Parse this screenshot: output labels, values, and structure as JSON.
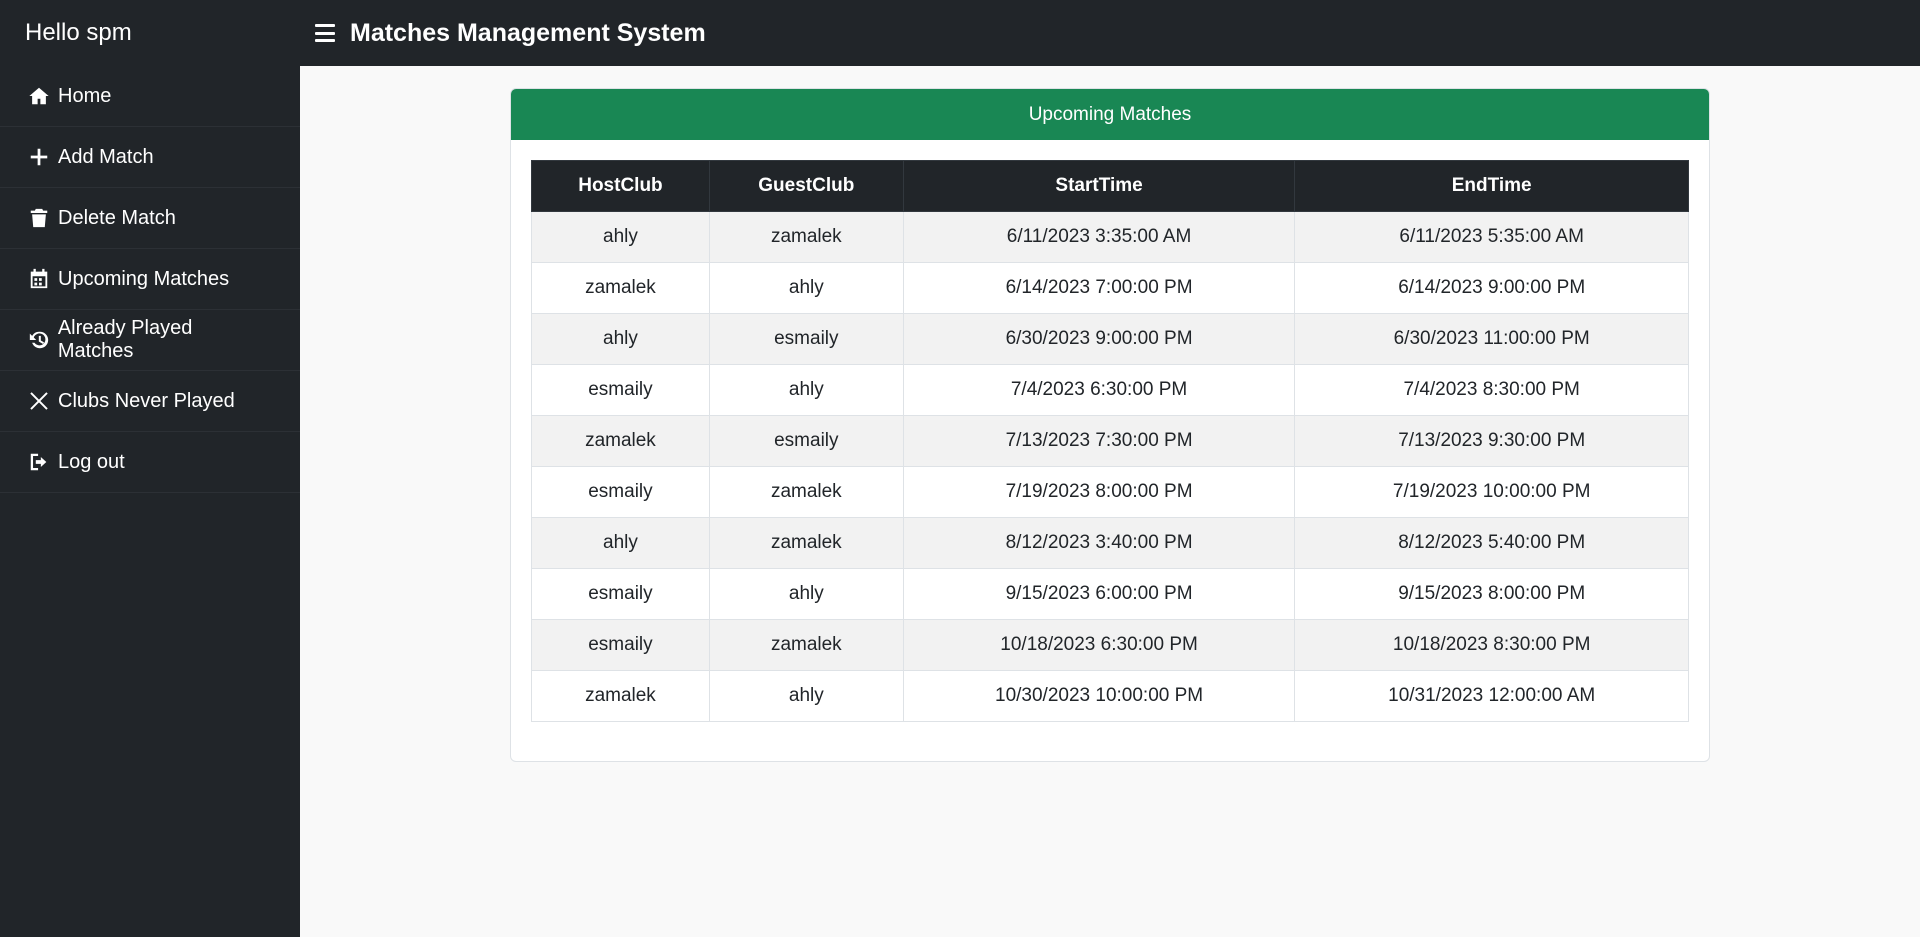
{
  "sidebar": {
    "greeting": "Hello spm",
    "items": [
      {
        "label": "Home",
        "icon": "home-icon"
      },
      {
        "label": "Add Match",
        "icon": "plus-icon"
      },
      {
        "label": "Delete Match",
        "icon": "trash-icon"
      },
      {
        "label": "Upcoming Matches",
        "icon": "calendar-icon"
      },
      {
        "label": "Already Played Matches",
        "icon": "history-icon"
      },
      {
        "label": "Clubs Never Played",
        "icon": "x-icon"
      },
      {
        "label": "Log out",
        "icon": "logout-icon"
      }
    ]
  },
  "header": {
    "title": "Matches Management System",
    "menu_icon": "hamburger-icon"
  },
  "main": {
    "card_title": "Upcoming Matches",
    "columns": [
      "HostClub",
      "GuestClub",
      "StartTime",
      "EndTime"
    ],
    "rows": [
      [
        "ahly",
        "zamalek",
        "6/11/2023 3:35:00 AM",
        "6/11/2023 5:35:00 AM"
      ],
      [
        "zamalek",
        "ahly",
        "6/14/2023 7:00:00 PM",
        "6/14/2023 9:00:00 PM"
      ],
      [
        "ahly",
        "esmaily",
        "6/30/2023 9:00:00 PM",
        "6/30/2023 11:00:00 PM"
      ],
      [
        "esmaily",
        "ahly",
        "7/4/2023 6:30:00 PM",
        "7/4/2023 8:30:00 PM"
      ],
      [
        "zamalek",
        "esmaily",
        "7/13/2023 7:30:00 PM",
        "7/13/2023 9:30:00 PM"
      ],
      [
        "esmaily",
        "zamalek",
        "7/19/2023 8:00:00 PM",
        "7/19/2023 10:00:00 PM"
      ],
      [
        "ahly",
        "zamalek",
        "8/12/2023 3:40:00 PM",
        "8/12/2023 5:40:00 PM"
      ],
      [
        "esmaily",
        "ahly",
        "9/15/2023 6:00:00 PM",
        "9/15/2023 8:00:00 PM"
      ],
      [
        "esmaily",
        "zamalek",
        "10/18/2023 6:30:00 PM",
        "10/18/2023 8:30:00 PM"
      ],
      [
        "zamalek",
        "ahly",
        "10/30/2023 10:00:00 PM",
        "10/31/2023 12:00:00 AM"
      ]
    ]
  },
  "colors": {
    "sidebar_bg": "#212529",
    "card_header_bg": "#198754",
    "page_bg": "#f9f9f9"
  }
}
